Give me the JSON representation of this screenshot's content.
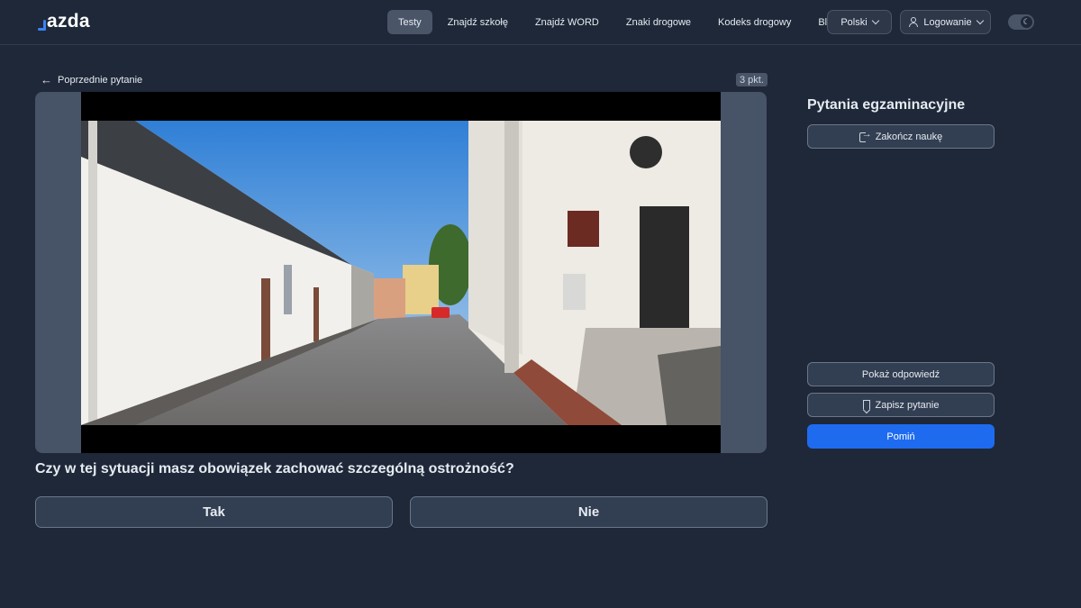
{
  "header": {
    "logo": "azda",
    "nav": [
      "Testy",
      "Znajdź szkołę",
      "Znajdź WORD",
      "Znaki drogowe",
      "Kodeks drogowy",
      "Blog"
    ],
    "active_nav": "Testy",
    "language": "Polski",
    "login": "Logowanie",
    "theme_icon": "moon-icon"
  },
  "question": {
    "prev_label": "Poprzednie pytanie",
    "points": "3 pkt.",
    "text": "Czy w tej sytuacji masz obowiązek zachować szczególną ostrożność?",
    "answers": {
      "yes": "Tak",
      "no": "Nie"
    },
    "media": "street-scene"
  },
  "panel": {
    "title": "Pytania egzaminacyjne",
    "finish": "Zakończ naukę",
    "show_answer": "Pokaż odpowiedź",
    "save": "Zapisz pytanie",
    "skip": "Pomiń"
  },
  "colors": {
    "background": "#1e2838",
    "accent": "#1e6bf0",
    "logo_accent": "#3b82f6"
  }
}
